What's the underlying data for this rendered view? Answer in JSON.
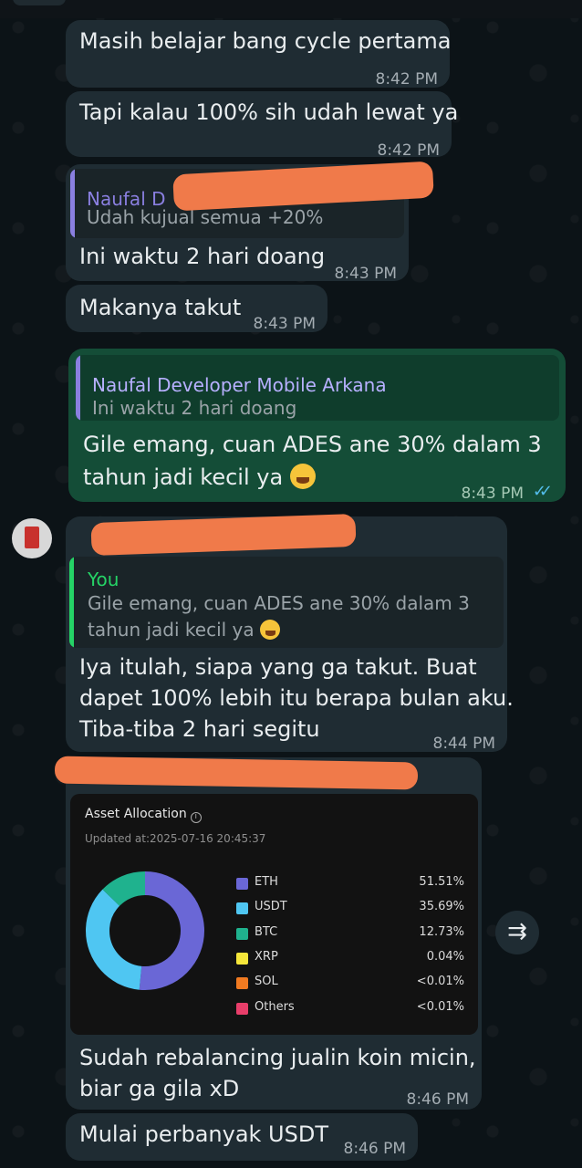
{
  "messages": [
    {
      "id": "m1",
      "text": "Masih belajar bang cycle pertama",
      "time": "8:42 PM"
    },
    {
      "id": "m2",
      "text": "Tapi kalau 100% sih udah lewat ya",
      "time": "8:42 PM"
    },
    {
      "id": "m3",
      "quote_name": "Naufal D",
      "quote_text": "Udah kujual semua +20%",
      "text": "Ini waktu 2 hari doang",
      "time": "8:43 PM"
    },
    {
      "id": "m4",
      "text": "Makanya takut",
      "time": "8:43 PM"
    },
    {
      "id": "m5",
      "quote_name": "Naufal Developer Mobile Arkana",
      "quote_text": "Ini waktu 2 hari doang",
      "line1": "Gile emang, cuan ADES ane 30% dalam 3",
      "line2": "tahun jadi kecil ya",
      "time": "8:43 PM"
    },
    {
      "id": "m6",
      "quote_name": "You",
      "quote_line1": "Gile emang, cuan ADES ane 30% dalam 3",
      "quote_line2": "tahun jadi kecil ya",
      "line1": "Iya itulah, siapa yang ga takut. Buat",
      "line2": "dapet 100% lebih itu berapa bulan aku.",
      "line3": "Tiba-tiba 2 hari segitu",
      "time": "8:44 PM"
    },
    {
      "id": "m7",
      "line1": "Sudah rebalancing jualin koin micin,",
      "line2": "biar ga gila xD",
      "time": "8:46 PM"
    },
    {
      "id": "m8",
      "text": "Mulai perbanyak USDT",
      "time": "8:46 PM"
    }
  ],
  "asset_card": {
    "title": "Asset Allocation",
    "updated": "Updated at:2025-07-16 20:45:37",
    "items": [
      {
        "name": "ETH",
        "percent": "51.51%",
        "value": 51.51,
        "color": "#6a67d6"
      },
      {
        "name": "USDT",
        "percent": "35.69%",
        "value": 35.69,
        "color": "#4fc6f2"
      },
      {
        "name": "BTC",
        "percent": "12.73%",
        "value": 12.73,
        "color": "#1fb28e"
      },
      {
        "name": "XRP",
        "percent": "0.04%",
        "value": 0.04,
        "color": "#f5e63a"
      },
      {
        "name": "SOL",
        "percent": "<0.01%",
        "value": 0.01,
        "color": "#f07a21"
      },
      {
        "name": "Others",
        "percent": "<0.01%",
        "value": 0.01,
        "color": "#e83e6a"
      }
    ]
  },
  "colors": {
    "incoming": "#1f2c33",
    "outgoing": "#144d37",
    "quote_bar_purple": "#8a7fe0",
    "quote_bar_green": "#25d366",
    "read_ticks": "#53bdeb",
    "redaction": "#f07a4a"
  },
  "icons": {
    "forward": "forward-icon",
    "info": "info-icon",
    "read": "double-check-icon"
  }
}
